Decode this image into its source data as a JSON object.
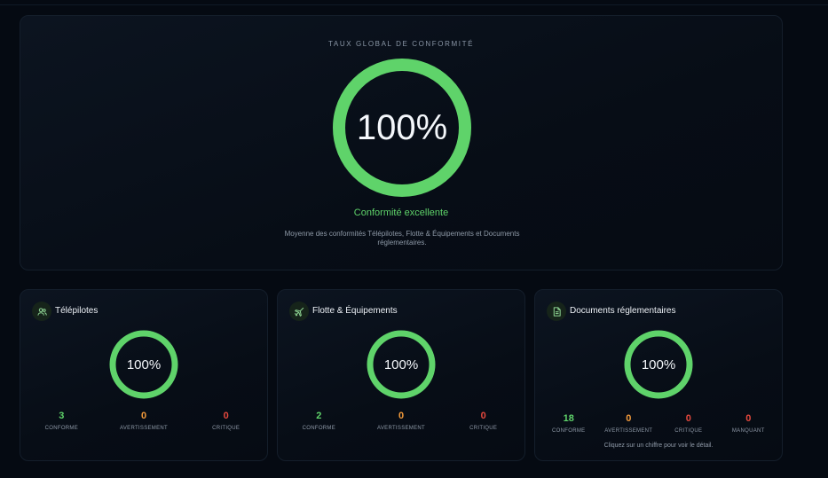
{
  "global": {
    "label": "TAUX GLOBAL DE CONFORMITÉ",
    "percent": "100%",
    "percent_value": 100,
    "status": "Conformité excellente",
    "description": "Moyenne des conformités Télépilotes, Flotte & Équipements et Documents réglementaires."
  },
  "colors": {
    "accent": "#5fd36a",
    "warning": "#f39a3a",
    "critical": "#e5483d",
    "background": "#050a12"
  },
  "cards": [
    {
      "title": "Télépilotes",
      "icon": "users-icon",
      "percent": "100%",
      "stats": [
        {
          "value": "3",
          "label": "CONFORME"
        },
        {
          "value": "0",
          "label": "AVERTISSEMENT"
        },
        {
          "value": "0",
          "label": "CRITIQUE"
        }
      ]
    },
    {
      "title": "Flotte & Équipements",
      "icon": "plane-icon",
      "percent": "100%",
      "stats": [
        {
          "value": "2",
          "label": "CONFORME"
        },
        {
          "value": "0",
          "label": "AVERTISSEMENT"
        },
        {
          "value": "0",
          "label": "CRITIQUE"
        }
      ]
    },
    {
      "title": "Documents réglementaires",
      "icon": "document-icon",
      "percent": "100%",
      "stats": [
        {
          "value": "18",
          "label": "CONFORME"
        },
        {
          "value": "0",
          "label": "AVERTISSEMENT"
        },
        {
          "value": "0",
          "label": "CRITIQUE"
        },
        {
          "value": "0",
          "label": "MANQUANT"
        }
      ],
      "hint": "Cliquez sur un chiffre pour voir le détail."
    }
  ]
}
